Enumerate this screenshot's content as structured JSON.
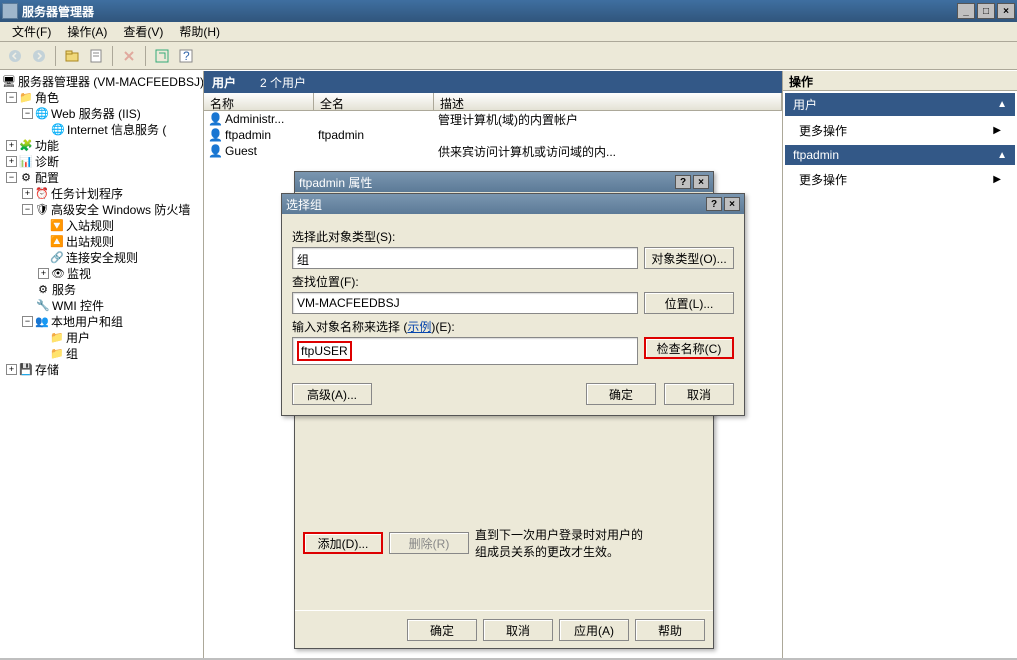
{
  "window": {
    "title": "服务器管理器",
    "min": "_",
    "max": "□",
    "close": "×"
  },
  "menu": {
    "file": "文件(F)",
    "action": "操作(A)",
    "view": "查看(V)",
    "help": "帮助(H)"
  },
  "tree": {
    "root": "服务器管理器 (VM-MACFEEDBSJ)",
    "roles": "角色",
    "web": "Web 服务器 (IIS)",
    "iis": "Internet 信息服务 (",
    "features": "功能",
    "diag": "诊断",
    "config": "配置",
    "task": "任务计划程序",
    "firewall": "高级安全 Windows 防火墙",
    "inbound": "入站规则",
    "outbound": "出站规则",
    "connsec": "连接安全规则",
    "monitor": "监视",
    "services": "服务",
    "wmi": "WMI 控件",
    "localusers": "本地用户和组",
    "users": "用户",
    "groups": "组",
    "storage": "存储"
  },
  "center": {
    "title": "用户",
    "count": "2 个用户",
    "col_name": "名称",
    "col_full": "全名",
    "col_desc": "描述",
    "rows": [
      {
        "name": "Administr...",
        "full": "",
        "desc": "管理计算机(域)的内置帐户"
      },
      {
        "name": "ftpadmin",
        "full": "ftpadmin",
        "desc": ""
      },
      {
        "name": "Guest",
        "full": "",
        "desc": "供来宾访问计算机或访问域的内..."
      }
    ]
  },
  "actions": {
    "header": "操作",
    "group1": "用户",
    "more": "更多操作",
    "group2": "ftpadmin"
  },
  "prop_dialog": {
    "title": "ftpadmin 属性",
    "add": "添加(D)...",
    "remove": "删除(R)",
    "info": "直到下一次用户登录时对用户的组成员关系的更改才生效。",
    "ok": "确定",
    "cancel": "取消",
    "apply": "应用(A)",
    "help": "帮助"
  },
  "select_dialog": {
    "title": "选择组",
    "obj_label": "选择此对象类型(S):",
    "obj_value": "组",
    "obj_btn": "对象类型(O)...",
    "loc_label": "查找位置(F):",
    "loc_value": "VM-MACFEEDBSJ",
    "loc_btn": "位置(L)...",
    "name_label_pre": "输入对象名称来选择 (",
    "name_label_link": "示例",
    "name_label_post": ")(E):",
    "name_value": "ftpUSER",
    "check_btn": "检查名称(C)",
    "advanced": "高级(A)...",
    "ok": "确定",
    "cancel": "取消"
  }
}
